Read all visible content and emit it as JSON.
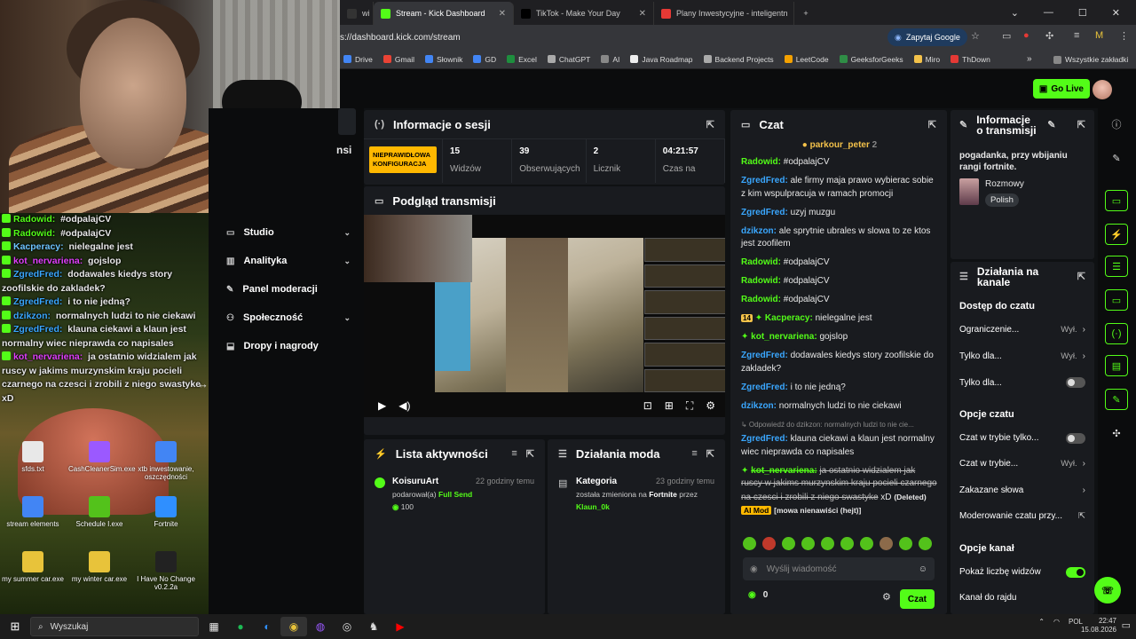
{
  "browser": {
    "tabs": [
      {
        "label": "wi",
        "color": "#333333",
        "active": false
      },
      {
        "label": "Stream - Kick Dashboard",
        "color": "#53fc18",
        "active": true
      },
      {
        "label": "TikTok - Make Your Day",
        "color": "#000000",
        "active": false
      },
      {
        "label": "Plany Inwestycyjne - inteligentn",
        "color": "#e53935",
        "active": false
      }
    ],
    "new_tab": "+",
    "url": "s://dashboard.kick.com/stream",
    "google_btn": "Zapytaj Google",
    "bookmarks": [
      "Drive",
      "Gmail",
      "Słownik",
      "GD",
      "Excel",
      "ChatGPT",
      "AI",
      "Java Roadmap",
      "Backend Projects",
      "LeetCode",
      "GeeksforGeeks",
      "Miro",
      "ThDown"
    ],
    "all_bookmarks": "Wszystkie zakładki",
    "more_bookmarks": "»"
  },
  "kick": {
    "go_live": "Go Live",
    "nav": [
      {
        "label": "Studio",
        "chev": "⌄"
      },
      {
        "label": "Analityka",
        "chev": "⌄"
      },
      {
        "label": "Panel moderacji",
        "chev": ""
      },
      {
        "label": "Społeczność",
        "chev": "⌄"
      },
      {
        "label": "Dropy i nagrody",
        "chev": ""
      }
    ],
    "nav_partial": "nsi",
    "session": {
      "title": "Informacje o sesji",
      "status": "NIEPRAWIDŁOWA KONFIGURACJA",
      "stats": [
        {
          "value": "15",
          "label": "Widzów"
        },
        {
          "value": "39",
          "label": "Obserwujących"
        },
        {
          "value": "2",
          "label": "Licznik"
        },
        {
          "value": "04:21:57",
          "label": "Czas na"
        }
      ]
    },
    "preview": {
      "title": "Podgląd transmisji"
    },
    "activity": {
      "title": "Lista aktywności",
      "items": [
        {
          "name": "KoisuruArt",
          "time": "22 godziny temu",
          "action": "podarował(a)",
          "item": "Full Send",
          "amount": "100"
        }
      ]
    },
    "modactions": {
      "title": "Działania moda",
      "items": [
        {
          "name": "Kategoria",
          "time": "23 godziny temu",
          "text1": "została zmieniona na",
          "target": "Fortnite",
          "text2": "przez",
          "by": "Klaun_0k"
        }
      ]
    },
    "chat": {
      "title": "Czat",
      "pinned_user": "parkour_peter",
      "pinned_count": "2",
      "messages": [
        {
          "user": "Radowid:",
          "text": "#odpalajCV",
          "color": "#53fc18"
        },
        {
          "user": "ZgredFred:",
          "text": "ale firmy maja prawo wybierac sobie z kim wspulpracuja w ramach promocji",
          "color": "#3aa7ff"
        },
        {
          "user": "ZgredFred:",
          "text": "uzyj muzgu",
          "color": "#3aa7ff"
        },
        {
          "user": "dzikzon:",
          "text": "ale sprytnie ubrales w slowa to ze ktos jest zoofilem",
          "color": "#3aa7ff"
        },
        {
          "user": "Radowid:",
          "text": "#odpalajCV",
          "color": "#53fc18"
        },
        {
          "user": "Radowid:",
          "text": "#odpalajCV",
          "color": "#53fc18"
        },
        {
          "user": "Radowid:",
          "text": "#odpalajCV",
          "color": "#53fc18"
        },
        {
          "user": "Kacperacy:",
          "text": "nielegalne jest",
          "color": "#53fc18",
          "badge": "14"
        },
        {
          "user": "kot_nervariena:",
          "text": "gojslop",
          "color": "#53fc18"
        },
        {
          "user": "ZgredFred:",
          "text": "dodawales kiedys story zoofilskie do zakladek?",
          "color": "#3aa7ff"
        },
        {
          "user": "ZgredFred:",
          "text": "i to nie jedną?",
          "color": "#3aa7ff"
        },
        {
          "user": "dzikzon:",
          "text": "normalnych ludzi to nie ciekawi",
          "color": "#3aa7ff"
        }
      ],
      "reply_note": "↳ Odpowiedź do dzikzon: normalnych ludzi to nie cie...",
      "reply_msg": {
        "user": "ZgredFred:",
        "text": "klauna ciekawi a klaun jest normalny wiec nieprawda co napisales"
      },
      "deleted_msg": {
        "user": "kot_nervariena:",
        "text": "ja ostatnio widzialem jak ruscy w jakims murzynskim kraju pocieli czarnego na czesci i zrobili z niego swastyke",
        "tail": "xD",
        "deleted": "(Deleted)",
        "aimod": "AI Mod",
        "reason": "[mowa nienawiści (hejt)]"
      },
      "input_placeholder": "Wyślij wiadomość",
      "points": "0",
      "send": "Czat"
    },
    "stream_info": {
      "title": "Informacje o transmisji",
      "description": "pogadanka, przy wbijaniu rangi fortnite.",
      "category": "Rozmowy",
      "language": "Polish"
    },
    "channel_actions": {
      "title": "Działania na kanale",
      "sections": [
        {
          "heading": "Dostęp do czatu",
          "rows": [
            {
              "label": "Ograniczenie...",
              "value": "Wył.",
              "kind": "chev"
            },
            {
              "label": "Tylko dla...",
              "value": "Wył.",
              "kind": "chev"
            },
            {
              "label": "Tylko dla...",
              "value": "",
              "kind": "toggle-off"
            }
          ]
        },
        {
          "heading": "Opcje czatu",
          "rows": [
            {
              "label": "Czat w trybie tylko...",
              "value": "",
              "kind": "toggle-off"
            },
            {
              "label": "Czat w trybie...",
              "value": "Wył.",
              "kind": "chev"
            },
            {
              "label": "Zakazane słowa",
              "value": "",
              "kind": "chev"
            },
            {
              "label": "Moderowanie czatu przy...",
              "value": "",
              "kind": "ext"
            }
          ]
        },
        {
          "heading": "Opcje kanał",
          "rows": [
            {
              "label": "Pokaż liczbę widzów",
              "value": "",
              "kind": "toggle-on"
            },
            {
              "label": "Kanał do rajdu",
              "value": "",
              "kind": "none"
            }
          ]
        }
      ]
    }
  },
  "overlay_chat": [
    {
      "user": "Radowid:",
      "text": "#odpalajCV",
      "color": "#53fc18"
    },
    {
      "user": "Radowid:",
      "text": "#odpalajCV",
      "color": "#53fc18"
    },
    {
      "user": "Kacperacy:",
      "text": "nielegalne jest",
      "color": "#6ec4ff"
    },
    {
      "user": "kot_nervariena:",
      "text": "gojslop",
      "color": "#e040fb"
    },
    {
      "user": "ZgredFred:",
      "text": "dodawales kiedys story zoofilskie do zakladek?",
      "color": "#3aa7ff"
    },
    {
      "user": "ZgredFred:",
      "text": "i to nie jedną?",
      "color": "#3aa7ff"
    },
    {
      "user": "dzikzon:",
      "text": "normalnych ludzi to nie ciekawi",
      "color": "#3aa7ff"
    },
    {
      "user": "ZgredFred:",
      "text": "klauna ciekawi a klaun jest normalny wiec nieprawda co napisales",
      "color": "#3aa7ff"
    },
    {
      "user": "kot_nervariena:",
      "text": "ja ostatnio widzialem jak ruscy w jakims murzynskim kraju pocieli czarnego na czesci i zrobili z niego swastyke xD",
      "color": "#e040fb"
    }
  ],
  "desktop_icons": [
    {
      "label": "sfds.txt",
      "color": "#e8e8e8"
    },
    {
      "label": "CashCleanerSim.exe",
      "color": "#9b59ff"
    },
    {
      "label": "xtb inwestowanie, oszczędności",
      "color": "#4285f4"
    },
    {
      "label": "stream elements",
      "color": "#4285f4"
    },
    {
      "label": "Schedule I.exe",
      "color": "#53c21b"
    },
    {
      "label": "Fortnite",
      "color": "#2f8fff"
    },
    {
      "label": "my summer car.exe",
      "color": "#e8c33a"
    },
    {
      "label": "my winter car.exe",
      "color": "#e8c33a"
    },
    {
      "label": "I Have No Change v0.2.2a",
      "color": "#222222"
    }
  ],
  "taskbar": {
    "search": "Wyszukaj",
    "lang": "POL",
    "time": "22:47",
    "date": "15.08.2026"
  }
}
